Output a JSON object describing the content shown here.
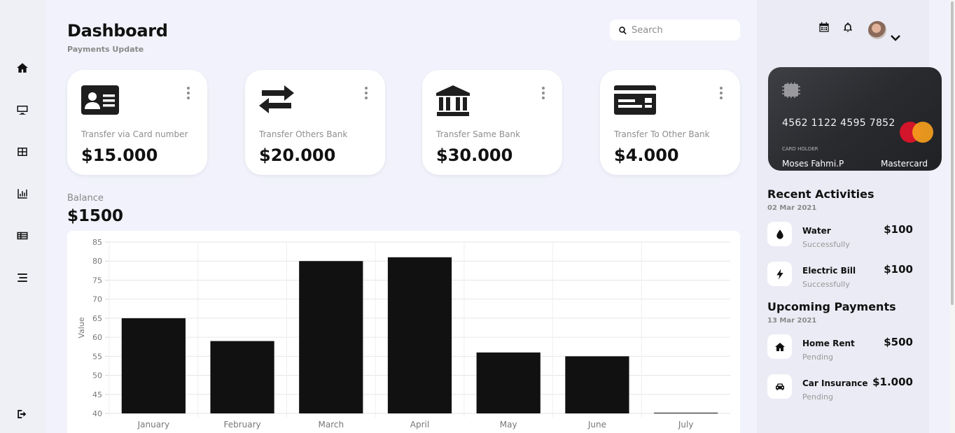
{
  "header": {
    "title": "Dashboard",
    "subtitle": "Payments Update",
    "search_placeholder": "Search"
  },
  "sidebar": {
    "items": [
      {
        "icon": "home-icon"
      },
      {
        "icon": "monitor-icon"
      },
      {
        "icon": "table-icon"
      },
      {
        "icon": "bar-chart-icon"
      },
      {
        "icon": "list-icon"
      },
      {
        "icon": "menu-icon"
      },
      {
        "icon": "logout-icon"
      }
    ]
  },
  "cards": [
    {
      "icon": "id-card-icon",
      "label": "Transfer via Card number",
      "amount": "$15.000"
    },
    {
      "icon": "transfer-arrows-icon",
      "label": "Transfer Others Bank",
      "amount": "$20.000"
    },
    {
      "icon": "bank-icon",
      "label": "Transfer Same Bank",
      "amount": "$30.000"
    },
    {
      "icon": "credit-card-icon",
      "label": "Transfer To Other Bank",
      "amount": "$4.000"
    }
  ],
  "balance": {
    "label": "Balance",
    "value": "$1500"
  },
  "chart_data": {
    "type": "bar",
    "categories": [
      "January",
      "February",
      "March",
      "April",
      "May",
      "June",
      "July"
    ],
    "values": [
      65,
      59,
      80,
      81,
      56,
      55,
      40
    ],
    "title": "",
    "xlabel": "",
    "ylabel": "Value",
    "ylim": [
      40,
      85
    ],
    "yticks": [
      40,
      45,
      50,
      55,
      60,
      65,
      70,
      75,
      80,
      85
    ],
    "bar_color": "#111111",
    "grid": true
  },
  "bank_card": {
    "number": "4562 1122 4595 7852",
    "holder_caption": "CARD HOLDER",
    "holder_name": "Moses Fahmi.P",
    "brand": "Mastercard"
  },
  "recent_activities": {
    "title": "Recent Activities",
    "date": "02 Mar 2021",
    "items": [
      {
        "icon": "water-drop-icon",
        "name": "Water",
        "status": "Successfully",
        "amount": "$100"
      },
      {
        "icon": "lightning-icon",
        "name": "Electric Bill",
        "status": "Successfully",
        "amount": "$100"
      }
    ]
  },
  "upcoming_payments": {
    "title": "Upcoming Payments",
    "date": "13 Mar 2021",
    "items": [
      {
        "icon": "home-icon",
        "name": "Home Rent",
        "status": "Pending",
        "amount": "$500"
      },
      {
        "icon": "car-icon",
        "name": "Car Insurance",
        "status": "Pending",
        "amount": "$1.000"
      }
    ]
  }
}
